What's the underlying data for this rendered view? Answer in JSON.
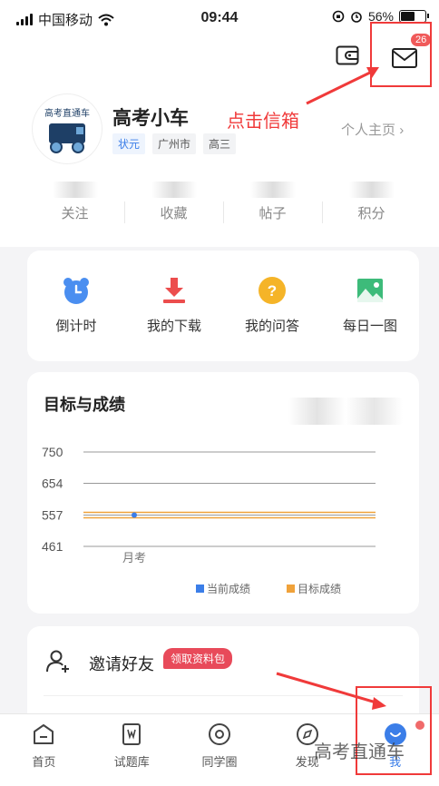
{
  "status_bar": {
    "carrier": "中国移动",
    "time": "09:44",
    "battery": "56%"
  },
  "header": {
    "mail_badge_count": "26",
    "annotation": "点击信箱",
    "avatar_text": "高考直通车",
    "username": "高考小车",
    "tags": [
      "状元",
      "广州市",
      "高三"
    ],
    "homepage_link": "个人主页",
    "stats": [
      {
        "label": "关注"
      },
      {
        "label": "收藏"
      },
      {
        "label": "帖子"
      },
      {
        "label": "积分"
      }
    ]
  },
  "shortcuts": [
    {
      "label": "倒计时",
      "icon": "alarm-clock-icon"
    },
    {
      "label": "我的下载",
      "icon": "download-icon"
    },
    {
      "label": "我的问答",
      "icon": "question-icon"
    },
    {
      "label": "每日一图",
      "icon": "image-icon"
    }
  ],
  "chart_data": {
    "type": "line",
    "title": "目标与成绩",
    "x": [
      "月考"
    ],
    "series": [
      {
        "name": "当前成绩",
        "values": [
          557
        ],
        "color": "#3b7ee8"
      },
      {
        "name": "目标成绩",
        "values": [
          557
        ],
        "color": "#f0a23a"
      }
    ],
    "yticks": [
      461,
      557,
      654,
      750
    ],
    "ylim": [
      461,
      750
    ],
    "grid": true,
    "legend": "bottom-right"
  },
  "invite": {
    "label": "邀请好友",
    "pill": "领取资料包"
  },
  "bottom_nav": [
    {
      "label": "首页",
      "icon": "home-icon"
    },
    {
      "label": "试题库",
      "icon": "question-bank-icon"
    },
    {
      "label": "同学圈",
      "icon": "circle-icon"
    },
    {
      "label": "发现",
      "icon": "compass-icon"
    },
    {
      "label": "我",
      "icon": "profile-icon"
    }
  ],
  "watermark": "高考直通车"
}
